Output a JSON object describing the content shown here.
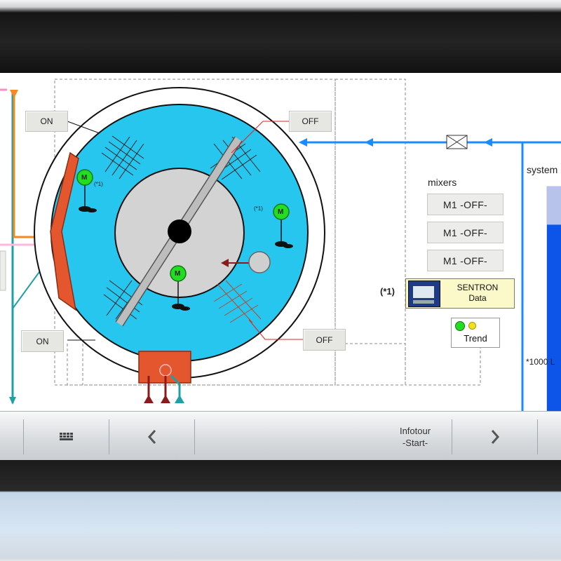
{
  "plant": {
    "buttons": {
      "top_left": "ON",
      "top_right": "OFF",
      "bottom_left": "ON",
      "bottom_right": "OFF"
    },
    "motor_tag": "M",
    "note_marker": "(*1)",
    "mixers_title": "mixers",
    "mixers": [
      "M1 -OFF-",
      "M1 -OFF-",
      "M1 -OFF-"
    ],
    "footnote_marker": "(*1)",
    "sentron": {
      "line1": "SENTRON",
      "line2": "Data"
    },
    "trend_label": "Trend",
    "system_label": "system",
    "tank_note": "*1000 L",
    "tank_level_percent": 83
  },
  "navbar": {
    "infotour_line1": "Infotour",
    "infotour_line2": "-Start-"
  },
  "colors": {
    "vessel": "#27c6ee",
    "pipe_blue": "#1a8cff",
    "pipe_orange": "#f5891f",
    "pipe_teal": "#1fa0a6",
    "heater_red": "#e4572e",
    "tank_blue": "#0d55e8"
  }
}
